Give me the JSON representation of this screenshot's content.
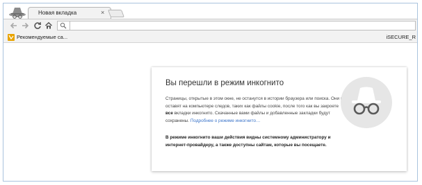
{
  "tabs": [
    {
      "title": "Новая вкладка",
      "close": "×"
    }
  ],
  "toolbar": {
    "back_icon": "←",
    "forward_icon": "→",
    "reload_icon": "C",
    "omnibox_value": ""
  },
  "bookmarks": {
    "items": [
      {
        "label": "Рекомендуемые са...",
        "icon": "bookmark-apps-icon"
      }
    ],
    "right_item": "iSECURE_R"
  },
  "incognito_page": {
    "title": "Вы перешли в режим инкогнито",
    "text_before_bold": "Страницы, открытые в этом окне, не останутся в истории браузера или поиска. Они не оставят на компьютере следов, таких как файлы cookie, после того как вы закроете ",
    "text_bold": "все",
    "text_after_bold": " вкладки инкогнито. Скачанные вами файлы и добавленные закладки будут сохранены. ",
    "link": "Подробнее о режиме инкогнито…",
    "warning": "В режиме инкогнито ваши действия видны системному администратору и интернет-провайдеру, а также доступны сайтам, которые вы посещаете."
  },
  "colors": {
    "frame_border": "#a9c3de",
    "chrome_bg": "#f2f2f2",
    "link": "#3b74c9",
    "bookmark_icon": "#e9a400"
  }
}
